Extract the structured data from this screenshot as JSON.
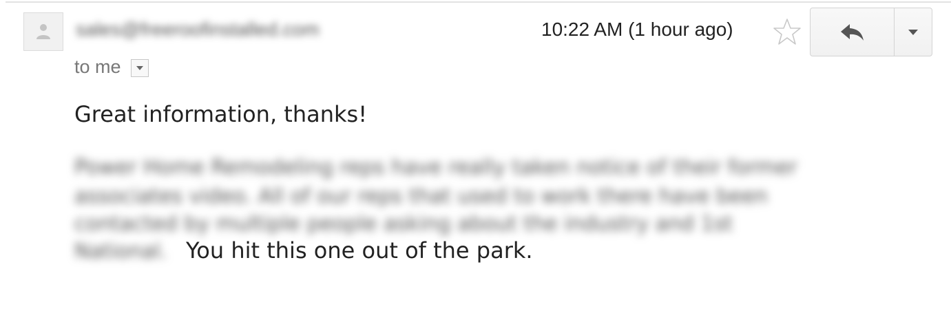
{
  "message": {
    "sender": "sales@freeroofinstalled.com",
    "recipient_label": "to me",
    "timestamp": "10:22 AM (1 hour ago)",
    "starred": false,
    "body": {
      "greeting": "Great information, thanks!",
      "redacted_lines": [
        "Power Home Remodeling reps have really taken notice of their former",
        "associates video. All of our reps that used to work there have been",
        "contacted by multiple people asking about the industry and 1st",
        "National."
      ],
      "closing": "You hit this one out of the park."
    }
  },
  "icons": {
    "avatar": "person-silhouette-icon",
    "recipient_toggle": "caret-down-icon",
    "star": "star-outline-icon",
    "reply": "reply-arrow-icon",
    "more": "caret-down-icon"
  },
  "colors": {
    "text": "#222222",
    "muted": "#777777",
    "border": "#d3d3d3",
    "icon": "#555555"
  }
}
